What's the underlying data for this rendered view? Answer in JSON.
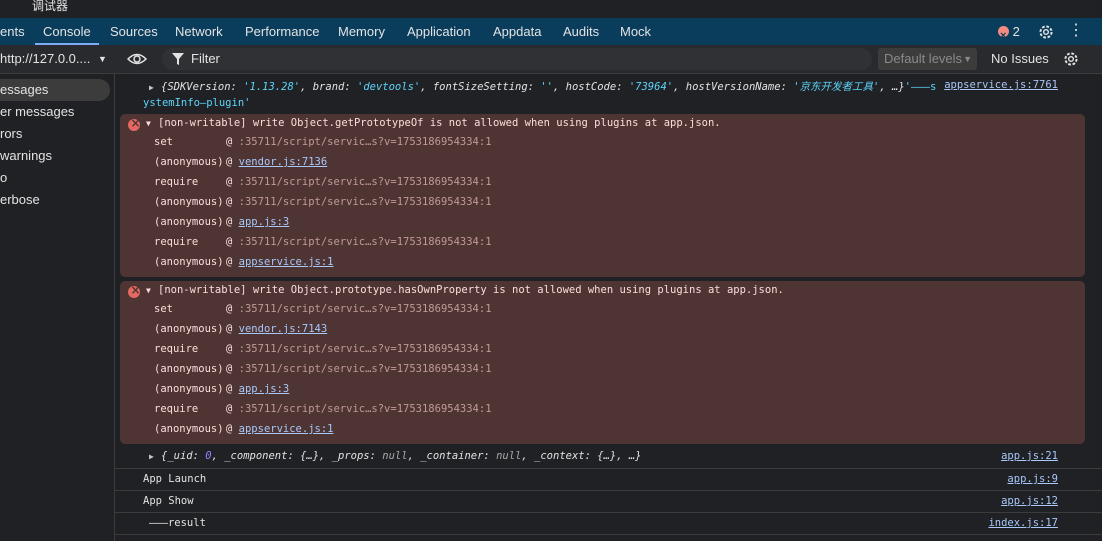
{
  "window": {
    "title": "调试器"
  },
  "tabs": [
    {
      "label": "ents"
    },
    {
      "label": "Console"
    },
    {
      "label": "Sources"
    },
    {
      "label": "Network"
    },
    {
      "label": "Performance"
    },
    {
      "label": "Memory"
    },
    {
      "label": "Application"
    },
    {
      "label": "Appdata"
    },
    {
      "label": "Audits"
    },
    {
      "label": "Mock"
    }
  ],
  "header": {
    "error_count": "2",
    "settings_icon": "gear-icon",
    "more_icon": "kebab-icon"
  },
  "toolbar": {
    "context": "http://127.0.0....",
    "filter_placeholder": "Filter",
    "levels": "Default levels",
    "issues": "No Issues"
  },
  "sidebar": {
    "items": [
      {
        "label": "essages"
      },
      {
        "label": "er messages"
      },
      {
        "label": "rors"
      },
      {
        "label": "warnings"
      },
      {
        "label": "o"
      },
      {
        "label": "erbose"
      }
    ]
  },
  "console": {
    "line1": {
      "p1": "{SDKVersion: ",
      "v1": "'1.13.28'",
      "p2": ", brand: ",
      "v2": "'devtools'",
      "p3": ", fontSizeSetting: ",
      "v3": "''",
      "p4": ", hostCode: ",
      "v4": "'73964'",
      "p5": ", hostVersionName: ",
      "v5": "'京东开发者工具'",
      "p6": ", …}",
      "tail": "'———s",
      "cont": "ystemInfo—plugin'",
      "source": "appservice.js:7761"
    },
    "errors": [
      {
        "message": "[non-writable] write Object.getPrototypeOf is not allowed when using plugins at app.json.",
        "frames": [
          {
            "fn": "set",
            "at": "@ ",
            "loc": ":35711/script/servic…s?v=1753186954334:1"
          },
          {
            "fn": "(anonymous)",
            "at": "@ ",
            "link": "vendor.js:7136"
          },
          {
            "fn": "require",
            "at": "@ ",
            "loc": ":35711/script/servic…s?v=1753186954334:1"
          },
          {
            "fn": "(anonymous)",
            "at": "@ ",
            "loc": ":35711/script/servic…s?v=1753186954334:1"
          },
          {
            "fn": "(anonymous)",
            "at": "@ ",
            "link": "app.js:3"
          },
          {
            "fn": "require",
            "at": "@ ",
            "loc": ":35711/script/servic…s?v=1753186954334:1"
          },
          {
            "fn": "(anonymous)",
            "at": "@ ",
            "link": "appservice.js:1"
          }
        ]
      },
      {
        "message": "[non-writable] write Object.prototype.hasOwnProperty is not allowed when using plugins at app.json.",
        "frames": [
          {
            "fn": "set",
            "at": "@ ",
            "loc": ":35711/script/servic…s?v=1753186954334:1"
          },
          {
            "fn": "(anonymous)",
            "at": "@ ",
            "link": "vendor.js:7143"
          },
          {
            "fn": "require",
            "at": "@ ",
            "loc": ":35711/script/servic…s?v=1753186954334:1"
          },
          {
            "fn": "(anonymous)",
            "at": "@ ",
            "loc": ":35711/script/servic…s?v=1753186954334:1"
          },
          {
            "fn": "(anonymous)",
            "at": "@ ",
            "link": "app.js:3"
          },
          {
            "fn": "require",
            "at": "@ ",
            "loc": ":35711/script/servic…s?v=1753186954334:1"
          },
          {
            "fn": "(anonymous)",
            "at": "@ ",
            "link": "appservice.js:1"
          }
        ]
      }
    ],
    "line2": {
      "p1": "{_uid: ",
      "v1": "0",
      "p2": ", _component: {…}, _props: ",
      "v2": "null",
      "p3": ", _container: ",
      "v3": "null",
      "p4": ", _context: {…}, …}",
      "source": "app.js:21"
    },
    "logs": [
      {
        "text": "App Launch",
        "source": "app.js:9"
      },
      {
        "text": "App Show",
        "source": "app.js:12"
      },
      {
        "text": "———result",
        "source": "index.js:17"
      }
    ]
  }
}
